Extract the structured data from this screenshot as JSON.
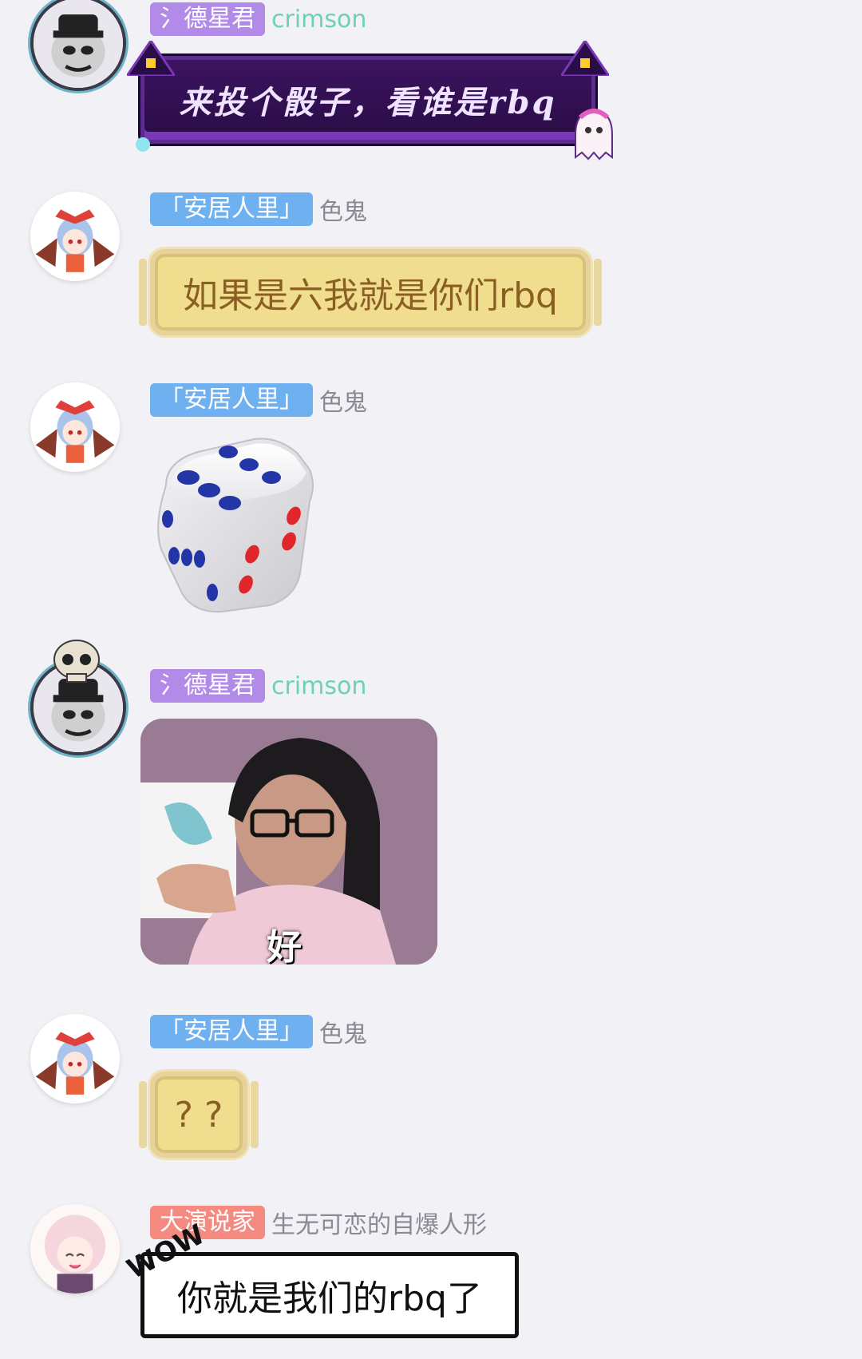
{
  "messages": [
    {
      "tag": "氵德星君",
      "nickname": "crimson",
      "text": "来投个骰子，看谁是rbq"
    },
    {
      "tag": "「安居人里」",
      "nickname": "色鬼",
      "text": "如果是六我就是你们rbq"
    },
    {
      "tag": "「安居人里」",
      "nickname": "色鬼",
      "dice_value": 6
    },
    {
      "tag": "氵德星君",
      "nickname": "crimson",
      "sticker_caption": "好"
    },
    {
      "tag": "「安居人里」",
      "nickname": "色鬼",
      "text": "? ?"
    },
    {
      "tag": "大演说家",
      "nickname": "生无可恋的自爆人形",
      "text": "你就是我们的rbq了",
      "badge": "WOW"
    }
  ],
  "colors": {
    "background": "#f1f1f6",
    "tag_purple": "#b28ae8",
    "tag_blue": "#6eb0f0",
    "tag_coral": "#f58a80",
    "nick_green": "#6dd2b2"
  }
}
